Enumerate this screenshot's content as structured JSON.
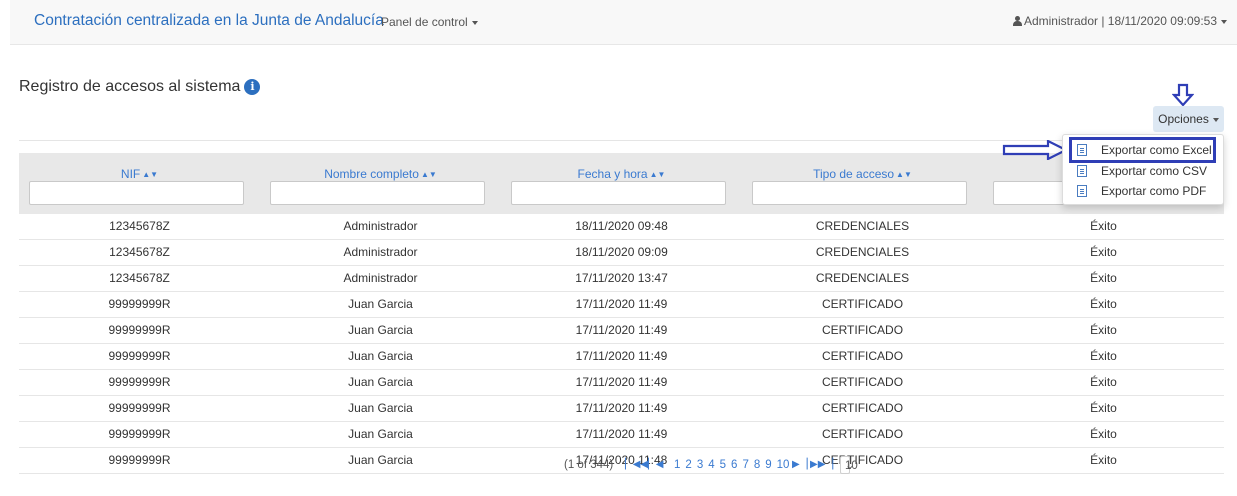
{
  "navbar": {
    "brand": "Contratación centralizada en la Junta de Andalucía",
    "panel_menu": "Panel de control",
    "user_info": "Administrador | 18/11/2020 09:09:53"
  },
  "page": {
    "title": "Registro de accesos al sistema"
  },
  "options_button": "Opciones",
  "options_menu": [
    {
      "label": "Exportar como Excel",
      "icon": "excel-file-icon"
    },
    {
      "label": "Exportar como CSV",
      "icon": "csv-file-icon"
    },
    {
      "label": "Exportar como PDF",
      "icon": "pdf-file-icon"
    }
  ],
  "table": {
    "columns": [
      "NIF",
      "Nombre completo",
      "Fecha y hora",
      "Tipo de acceso",
      ""
    ],
    "rows": [
      [
        "12345678Z",
        "Administrador",
        "18/11/2020 09:48",
        "CREDENCIALES",
        "Éxito"
      ],
      [
        "12345678Z",
        "Administrador",
        "18/11/2020 09:09",
        "CREDENCIALES",
        "Éxito"
      ],
      [
        "12345678Z",
        "Administrador",
        "17/11/2020 13:47",
        "CREDENCIALES",
        "Éxito"
      ],
      [
        "99999999R",
        "Juan Garcia",
        "17/11/2020 11:49",
        "CERTIFICADO",
        "Éxito"
      ],
      [
        "99999999R",
        "Juan Garcia",
        "17/11/2020 11:49",
        "CERTIFICADO",
        "Éxito"
      ],
      [
        "99999999R",
        "Juan Garcia",
        "17/11/2020 11:49",
        "CERTIFICADO",
        "Éxito"
      ],
      [
        "99999999R",
        "Juan Garcia",
        "17/11/2020 11:49",
        "CERTIFICADO",
        "Éxito"
      ],
      [
        "99999999R",
        "Juan Garcia",
        "17/11/2020 11:49",
        "CERTIFICADO",
        "Éxito"
      ],
      [
        "99999999R",
        "Juan Garcia",
        "17/11/2020 11:49",
        "CERTIFICADO",
        "Éxito"
      ],
      [
        "99999999R",
        "Juan Garcia",
        "17/11/2020 11:48",
        "CERTIFICADO",
        "Éxito"
      ]
    ]
  },
  "pagination": {
    "summary": "(1 of 344)",
    "pages": [
      "1",
      "2",
      "3",
      "4",
      "5",
      "6",
      "7",
      "8",
      "9",
      "10"
    ],
    "page_size": "10"
  },
  "colors": {
    "brand": "#2c6fbf",
    "link": "#3a7ad0",
    "header_bg": "#e8e8e8",
    "annotation": "#2f3eb6"
  }
}
